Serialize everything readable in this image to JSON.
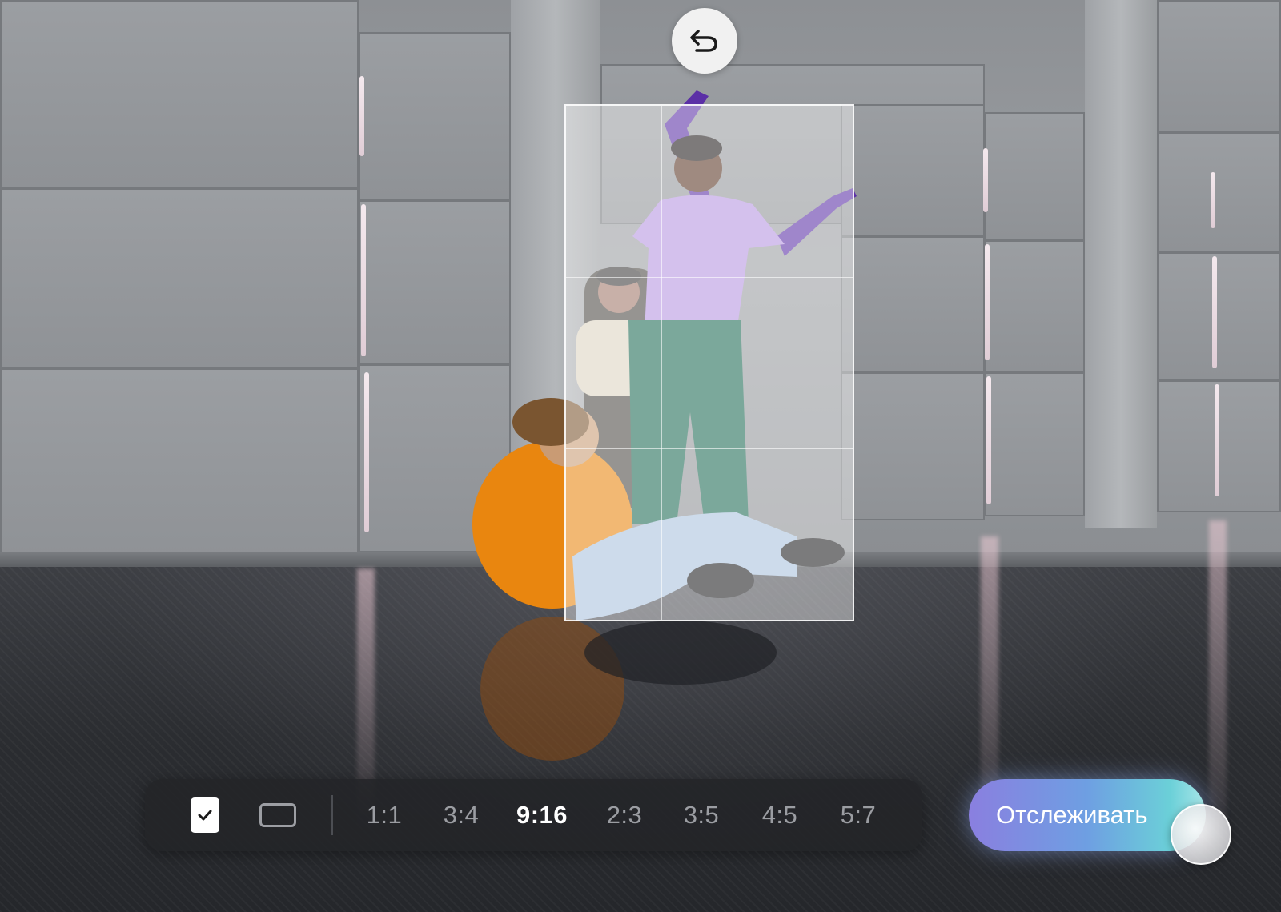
{
  "undo": {
    "icon": "undo-arrow-icon"
  },
  "toolbar": {
    "check_icon": "checkbox-checked-icon",
    "landscape_icon": "landscape-frame-icon",
    "ratios": [
      {
        "label": "1:1"
      },
      {
        "label": "3:4"
      },
      {
        "label": "9:16",
        "active": true
      },
      {
        "label": "2:3"
      },
      {
        "label": "3:5"
      },
      {
        "label": "4:5"
      },
      {
        "label": "5:7"
      }
    ],
    "selected_ratio": "9:16"
  },
  "track_button": {
    "label": "Отслеживать"
  },
  "colors": {
    "toolbar_bg": "#232428",
    "ratio_inactive": "#9b9da2",
    "ratio_active": "#ffffff",
    "track_gradient_start": "#8a7fe0",
    "track_gradient_end": "#a9e6e8"
  }
}
